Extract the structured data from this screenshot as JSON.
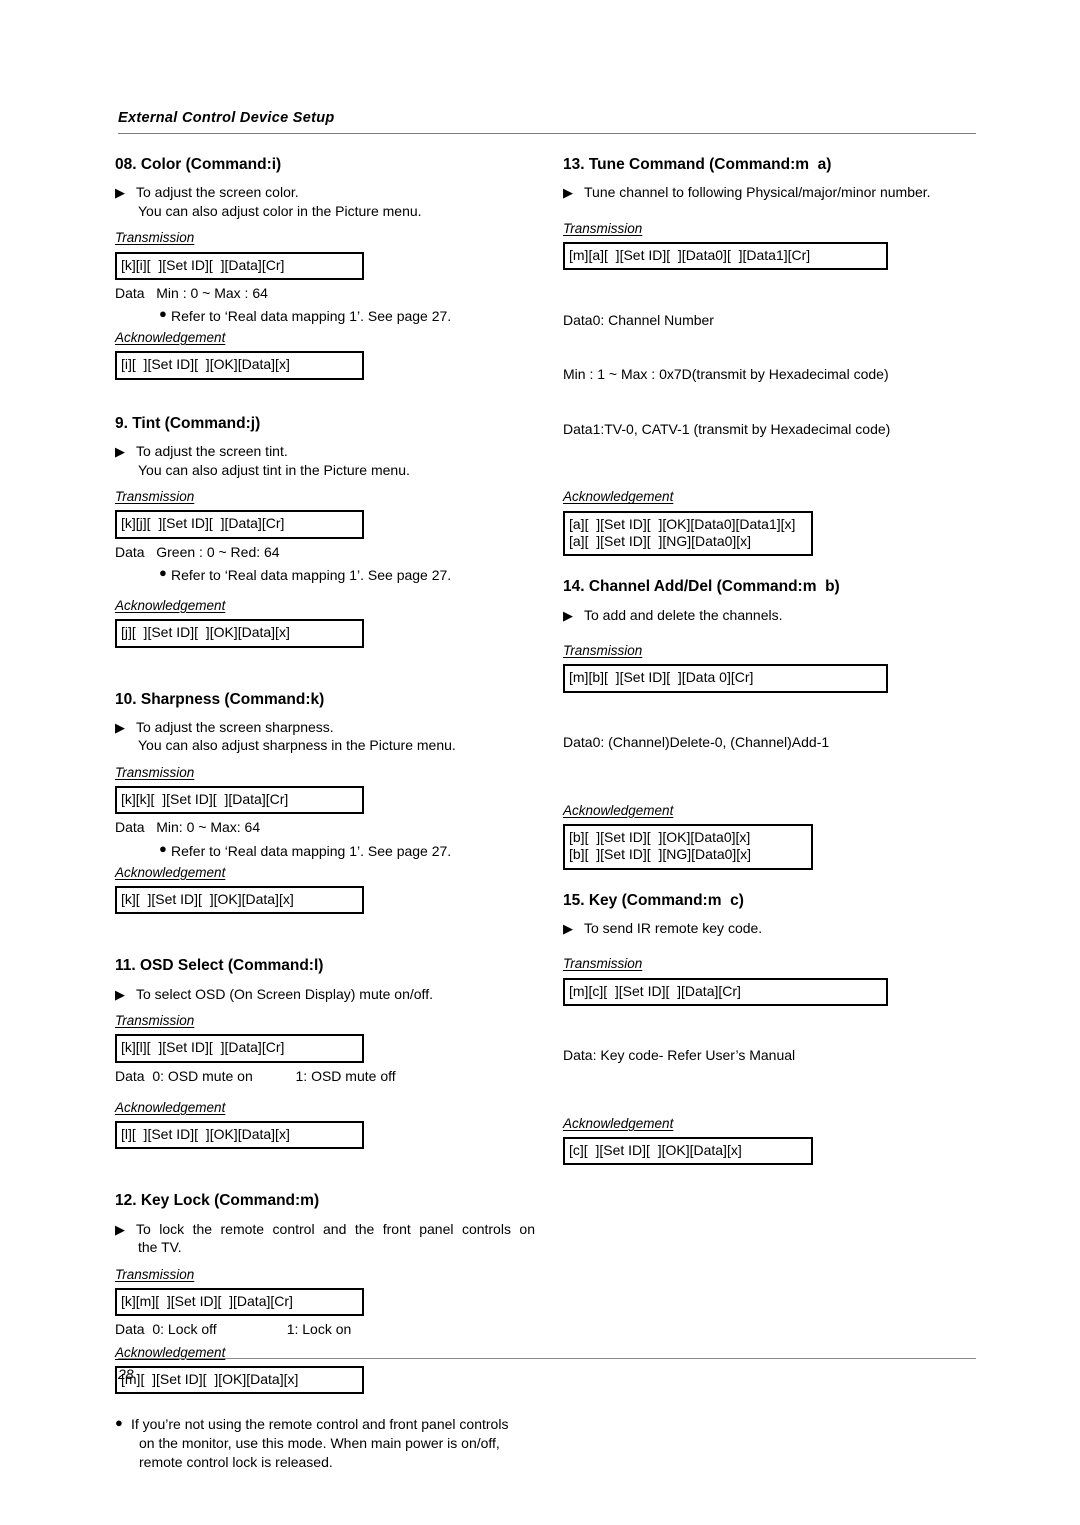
{
  "header": {
    "title": "External Control Device Setup"
  },
  "footer": {
    "page_number": "28"
  },
  "markers": {
    "triangle": "▶",
    "dot": "●"
  },
  "labels": {
    "transmission": "Transmission",
    "acknowledgement": "Acknowledgement"
  },
  "left_column": {
    "sections": [
      {
        "title": "08. Color (Command:i)",
        "desc_line1": "To adjust the screen color.",
        "desc_line2": "You can also adjust color in the Picture menu.",
        "transmission_code": "[k][i][  ][Set ID][  ][Data][Cr]",
        "data_note": "Data   Min : 0 ~ Max : 64",
        "bullet_note": "Refer to ‘Real data mapping 1’. See page 27.",
        "ack_code": "[i][  ][Set ID][  ][OK][Data][x]"
      },
      {
        "title": "9. Tint (Command:j)",
        "desc_line1": "To adjust the screen tint.",
        "desc_line2": "You can also adjust tint in the Picture menu.",
        "transmission_code": "[k][j][  ][Set ID][  ][Data][Cr]",
        "data_note": "Data   Green : 0 ~ Red: 64",
        "bullet_note": "Refer to ‘Real data mapping 1’. See page 27.",
        "ack_code": "[j][  ][Set ID][  ][OK][Data][x]"
      },
      {
        "title": "10. Sharpness (Command:k)",
        "desc_line1": "To adjust the screen sharpness.",
        "desc_line2": "You can also adjust sharpness in the Picture menu.",
        "transmission_code": "[k][k][  ][Set ID][  ][Data][Cr]",
        "data_note": "Data   Min: 0 ~ Max: 64",
        "bullet_note": "Refer to ‘Real data mapping 1’. See page 27.",
        "ack_code": "[k][  ][Set ID][  ][OK][Data][x]"
      },
      {
        "title": "11. OSD Select (Command:l)",
        "desc_line1": "To select OSD (On Screen Display) mute on/off.",
        "transmission_code": "[k][l][  ][Set ID][  ][Data][Cr]",
        "data_note": "Data  0: OSD mute on           1: OSD mute off",
        "ack_code": "[l][  ][Set ID][  ][OK][Data][x]"
      },
      {
        "title": "12. Key Lock (Command:m)",
        "desc_line1": "To lock the remote control and the front panel controls on",
        "desc_line2": "the TV.",
        "transmission_code": "[k][m][  ][Set ID][  ][Data][Cr]",
        "data_note": "Data  0: Lock off                  1: Lock on",
        "ack_code": "[m][  ][Set ID][  ][OK][Data][x]",
        "footnote_line1": "If you’re not using the remote control and front panel controls",
        "footnote_line2": "on the monitor, use this mode. When main power is on/off,",
        "footnote_line3": "remote control lock is released."
      }
    ]
  },
  "right_column": {
    "sections": [
      {
        "title": "13. Tune Command (Command:m  a)",
        "desc_line1": "Tune channel to following Physical/major/minor number.",
        "transmission_code": "[m][a][  ][Set ID][  ][Data0][  ][Data1][Cr]",
        "data_note_line1": "Data0: Channel Number",
        "data_note_line2": "Min : 1 ~ Max : 0x7D(transmit by Hexadecimal code)",
        "data_note_line3": "Data1:TV-0, CATV-1 (transmit by Hexadecimal code)",
        "ack_code_line1": "[a][  ][Set ID][  ][OK][Data0][Data1][x]",
        "ack_code_line2": "[a][  ][Set ID][  ][NG][Data0][x]"
      },
      {
        "title": "14. Channel Add/Del (Command:m  b)",
        "desc_line1": "To add and delete the channels.",
        "transmission_code": "[m][b][  ][Set ID][  ][Data 0][Cr]",
        "data_note_line1": "Data0: (Channel)Delete-0, (Channel)Add-1",
        "ack_code_line1": "[b][  ][Set ID][  ][OK][Data0][x]",
        "ack_code_line2": "[b][  ][Set ID][  ][NG][Data0][x]"
      },
      {
        "title": "15. Key (Command:m  c)",
        "desc_line1": "To send IR remote key code.",
        "transmission_code": "[m][c][  ][Set ID][  ][Data][Cr]",
        "data_note_line1": "Data: Key code- Refer User’s Manual",
        "ack_code_line1": "[c][  ][Set ID][  ][OK][Data][x]"
      }
    ]
  }
}
